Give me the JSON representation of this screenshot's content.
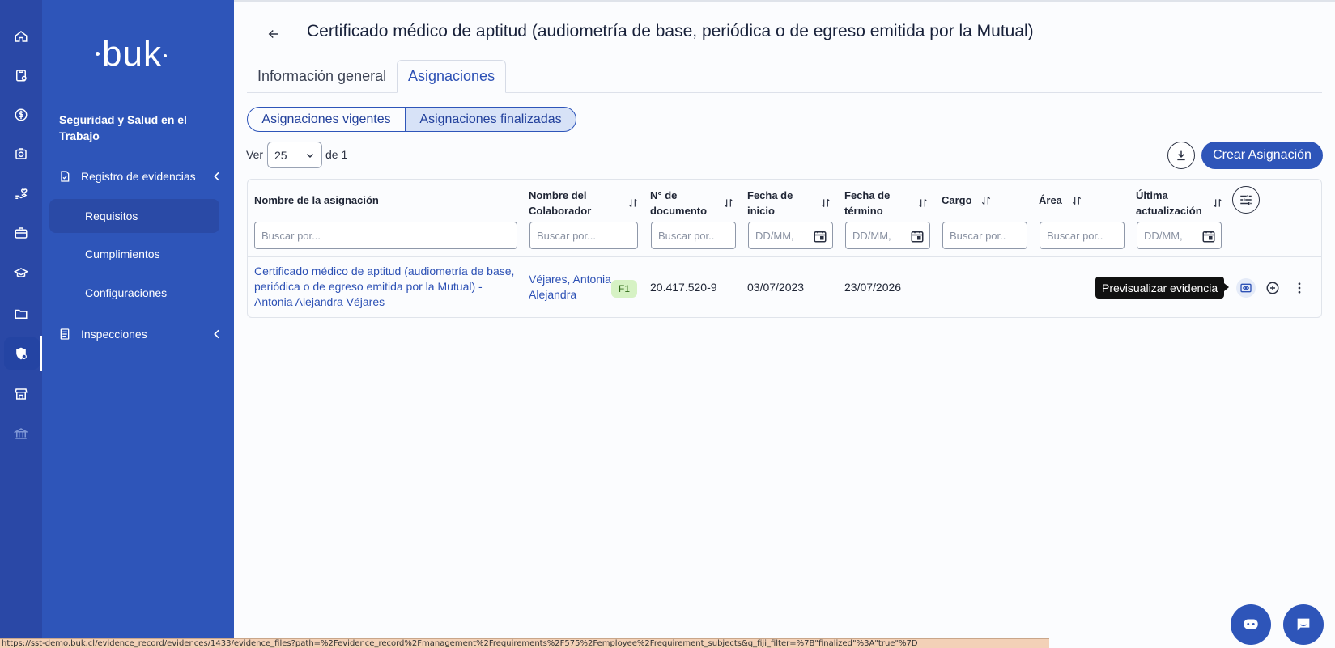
{
  "app": {
    "logo_text": "buk"
  },
  "sidebar": {
    "section_title": "Seguridad y Salud en el Trabajo",
    "groups": [
      {
        "label": "Registro de evidencias",
        "expanded": true,
        "items": [
          {
            "label": "Requisitos",
            "active": true
          },
          {
            "label": "Cumplimientos",
            "active": false
          },
          {
            "label": "Configuraciones",
            "active": false
          }
        ]
      },
      {
        "label": "Inspecciones",
        "expanded": false,
        "items": []
      }
    ]
  },
  "rail_icons": [
    "home-icon",
    "clipboard-icon",
    "dollar-icon",
    "camera-icon",
    "hand-heart-icon",
    "briefcase-icon",
    "graduation-cap-icon",
    "folder-icon",
    "shield-gear-icon",
    "store-icon",
    "bank-icon"
  ],
  "header": {
    "title": "Certificado médico de aptitud (audiometría de base, periódica o de egreso emitida por la Mutual)"
  },
  "tabs": [
    {
      "label": "Información general",
      "active": false
    },
    {
      "label": "Asignaciones",
      "active": true
    }
  ],
  "segments": [
    {
      "label": "Asignaciones vigentes",
      "active": false
    },
    {
      "label": "Asignaciones finalizadas",
      "active": true
    }
  ],
  "pagination": {
    "ver_label": "Ver",
    "page_size": "25",
    "de_label": "de 1"
  },
  "toolbar": {
    "create_label": "Crear Asignación"
  },
  "table": {
    "columns": [
      {
        "label": "Nombre de la asignación",
        "sortable": false,
        "filter": "Buscar por..."
      },
      {
        "label": "Nombre del Colaborador",
        "sortable": true,
        "filter": "Buscar por..."
      },
      {
        "label": "N° de documento",
        "sortable": true,
        "filter": "Buscar por.."
      },
      {
        "label": "Fecha de inicio",
        "sortable": true,
        "filter": "DD/MM,"
      },
      {
        "label": "Fecha de término",
        "sortable": true,
        "filter": "DD/MM,"
      },
      {
        "label": "Cargo",
        "sortable": true,
        "filter": "Buscar por.."
      },
      {
        "label": "Área",
        "sortable": true,
        "filter": "Buscar por.."
      },
      {
        "label": "Última actualización",
        "sortable": true,
        "filter": "DD/MM,"
      }
    ],
    "rows": [
      {
        "assignment": "Certificado médico de aptitud (audiometría de base, periódica o de egreso emitida por la Mutual) - Antonia Alejandra Véjares",
        "employee": "Véjares, Antonia Alejandra",
        "badge": "F1",
        "document": "20.417.520-9",
        "start": "03/07/2023",
        "end": "23/07/2026",
        "cargo": "",
        "area": "",
        "updated": ""
      }
    ]
  },
  "tooltip": "Previsualizar evidencia",
  "statusbar": "https://sst-demo.buk.cl/evidence_record/evidences/1433/evidence_files?path=%2Fevidence_record%2Fmanagement%2Frequirements%2F575%2Femployee%2Frequirement_subjects&q_fiji_filter=%7B\"finalized\"%3A\"true\"%7D",
  "colors": {
    "rail": "#2a48a6",
    "sidebar": "#2e55b9",
    "accent": "#2e55b9",
    "badge_bg": "#d6f2c4"
  }
}
